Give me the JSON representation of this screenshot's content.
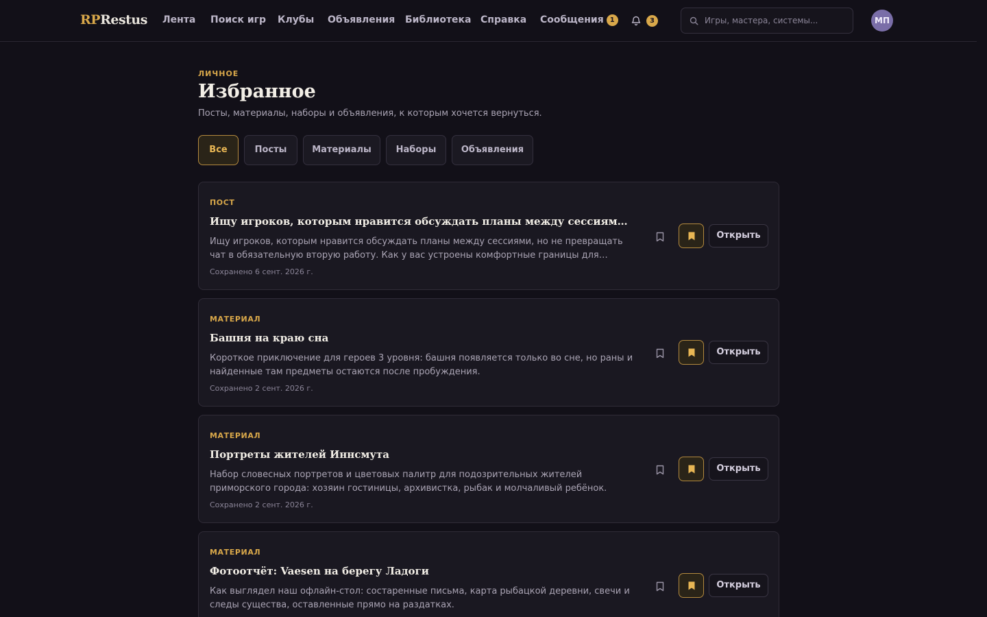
{
  "brand": {
    "prefix": "RP",
    "name": "Restus"
  },
  "nav": [
    {
      "label": "Лента"
    },
    {
      "label": "Поиск игр"
    },
    {
      "label": "Клубы"
    },
    {
      "label": "Объявления"
    },
    {
      "label": "Библиотека"
    },
    {
      "label": "Справка"
    },
    {
      "label": "Сообщения",
      "badge": "1"
    }
  ],
  "notifications": {
    "icon": "bell-icon",
    "count": "3"
  },
  "search": {
    "placeholder": "Игры, мастера, системы...",
    "icon": "search-icon"
  },
  "user": {
    "initials": "МП"
  },
  "page": {
    "eyebrow": "ЛИЧНОЕ",
    "title": "Избранное",
    "subtitle": "Посты, материалы, наборы и объявления, к которым хочется вернуться."
  },
  "filters": {
    "active": "Все",
    "items": [
      "Все",
      "Посты",
      "Материалы",
      "Наборы",
      "Объявления"
    ]
  },
  "cards": [
    {
      "type": "ПОСТ",
      "title": "Ищу игроков, которым нравится обсуждать планы между сессиями, но не превращать чат в обязательную вторую работу",
      "excerpt": "Ищу игроков, которым нравится обсуждать планы между сессиями, но не превращать чат в обязательную вторую работу. Как у вас устроены комфортные границы для обсуждений между играми?",
      "date": "Сохранено 6 сент. 2026 г.",
      "open_label": "Открыть"
    },
    {
      "type": "МАТЕРИАЛ",
      "title": "Башня на краю сна",
      "excerpt": "Короткое приключение для героев 3 уровня: башня появляется только во сне, но раны и найденные там предметы остаются после пробуждения.",
      "date": "Сохранено 2 сент. 2026 г.",
      "open_label": "Открыть"
    },
    {
      "type": "МАТЕРИАЛ",
      "title": "Портреты жителей Иннсмута",
      "excerpt": "Набор словесных портретов и цветовых палитр для подозрительных жителей приморского города: хозяин гостиницы, архивистка, рыбак и молчаливый ребёнок.",
      "date": "Сохранено 2 сент. 2026 г.",
      "open_label": "Открыть"
    },
    {
      "type": "МАТЕРИАЛ",
      "title": "Фотоотчёт: Vaesen на берегу Ладоги",
      "excerpt": "Как выглядел наш офлайн-стол: состаренные письма, карта рыбацкой деревни, свечи и следы существа, оставленные прямо на раздатках.",
      "date": "",
      "open_label": "Открыть"
    }
  ],
  "colors": {
    "background": "#121018",
    "accent": "#d9a84a",
    "card": "#1a1821",
    "avatar": "#7a6ea8"
  }
}
